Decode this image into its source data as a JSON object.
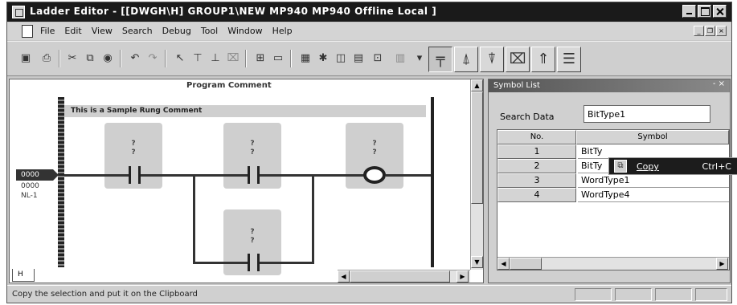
{
  "window": {
    "title": "Ladder Editor - [[DWGH\\H]   GROUP1\\NEW  MP940  MP940     Offline  Local  ]"
  },
  "menu": {
    "items": [
      "File",
      "Edit",
      "View",
      "Search",
      "Debug",
      "Tool",
      "Window",
      "Help"
    ]
  },
  "toolbar": {
    "icons": [
      "save-icon",
      "print-icon",
      "cut-icon",
      "copy-icon",
      "paste-icon",
      "undo-icon",
      "redo-icon",
      "select-icon",
      "contact-icon",
      "coil-icon",
      "delete-icon",
      "find-icon",
      "monitor-icon"
    ]
  },
  "ladder": {
    "program_comment": "Program Comment",
    "rung_comment": "This is a Sample Rung Comment",
    "rung_number": "0000",
    "rung_line2": "0000",
    "rung_line3": "NL-1",
    "element_placeholder": "?",
    "sheet_tab": "H"
  },
  "symbol_list": {
    "title": "Symbol List",
    "search_label": "Search Data",
    "search_value": "BitType1",
    "columns": [
      "No.",
      "Symbol"
    ],
    "rows": [
      {
        "no": "1",
        "symbol": "BitTy"
      },
      {
        "no": "2",
        "symbol": "BitTy"
      },
      {
        "no": "3",
        "symbol": "WordType1"
      },
      {
        "no": "4",
        "symbol": "WordType4"
      }
    ],
    "context_menu": {
      "label": "Copy",
      "shortcut": "Ctrl+C"
    }
  },
  "status": {
    "text": "Copy the selection and put it on the Clipboard"
  }
}
